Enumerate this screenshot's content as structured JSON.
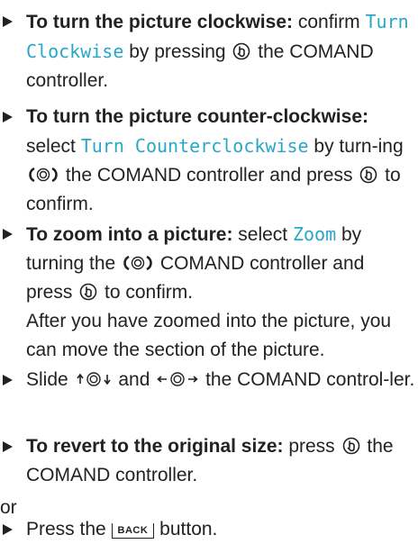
{
  "items": [
    {
      "bold": "To turn the picture clockwise:",
      "t1": " confirm ",
      "tele": "Turn Clockwise",
      "t2": " by pressing ",
      "t3": " the COMAND controller."
    },
    {
      "bold": "To turn the picture counter-clockwise:",
      "t1": " select ",
      "tele": "Turn Counterclockwise",
      "t2": " by turn-ing ",
      "t3": " the COMAND controller and press ",
      "t4": " to confirm."
    },
    {
      "bold": "To zoom into a picture:",
      "t1": " select ",
      "tele": "Zoom",
      "t2": " by turning the ",
      "t3": " COMAND controller and press ",
      "t4": " to confirm.",
      "t5": "After you have zoomed into the picture, you can move the section of the picture."
    },
    {
      "t1": "Slide ",
      "t2": " and ",
      "t3": " the COMAND control-ler."
    },
    {
      "bold": "To revert to the original size:",
      "t1": " press ",
      "t2": " the COMAND controller."
    }
  ],
  "or_text": "or",
  "last": {
    "t1": "Press the ",
    "key": "BACK",
    "t2": " button."
  },
  "icons": {
    "press": "press-controller-icon",
    "turn": "turn-controller-icon",
    "slide_vertical": "slide-up-down-icon",
    "slide_horizontal": "slide-left-right-icon",
    "bullet": "triangle-bullet-icon"
  },
  "colors": {
    "telltale": "#2aa6c8",
    "text": "#222222"
  }
}
